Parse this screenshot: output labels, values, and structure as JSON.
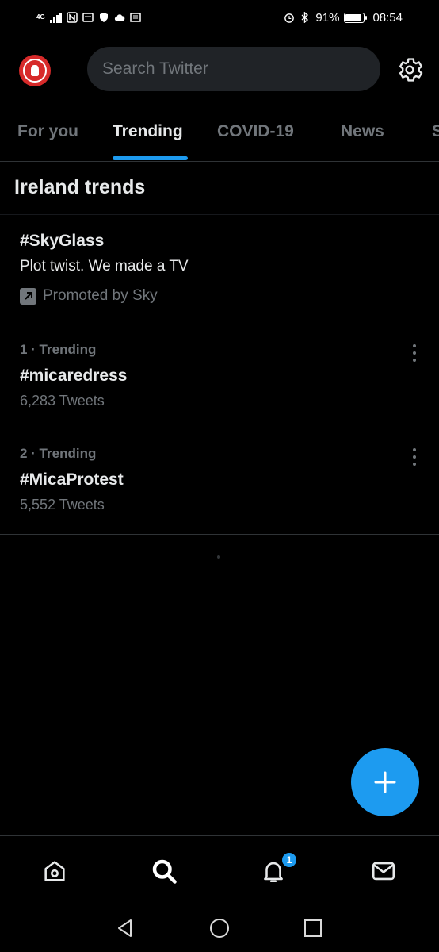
{
  "status_bar": {
    "network_type": "4G",
    "battery_percent": "91%",
    "battery_level": 0.91,
    "time": "08:54",
    "icons": [
      "signal-bars-icon",
      "nfc-icon",
      "news-icon",
      "shield-icon",
      "cloud-icon",
      "newspaper-icon",
      "alarm-icon",
      "bluetooth-icon",
      "battery-icon"
    ]
  },
  "header": {
    "avatar_icon": "profile-avatar-icon",
    "search_placeholder": "Search Twitter",
    "settings_icon": "gear-icon"
  },
  "tabs": [
    {
      "label": "For you",
      "active": false
    },
    {
      "label": "Trending",
      "active": true
    },
    {
      "label": "COVID-19",
      "active": false
    },
    {
      "label": "News",
      "active": false
    },
    {
      "label": "S",
      "active": false
    }
  ],
  "section_title": "Ireland trends",
  "promoted": {
    "title": "#SkyGlass",
    "description": "Plot twist. We made a TV",
    "promoted_label": "Promoted by Sky",
    "icon": "promoted-arrow-icon"
  },
  "trends": [
    {
      "meta": "1 · Trending",
      "name": "#micaredress",
      "count": "6,283 Tweets"
    },
    {
      "meta": "2 · Trending",
      "name": "#MicaProtest",
      "count": "5,552 Tweets"
    }
  ],
  "fab": {
    "icon": "plus-icon"
  },
  "bottom_nav": {
    "items": [
      "home-icon",
      "search-icon",
      "notifications-icon",
      "messages-icon"
    ],
    "notification_badge": "1"
  },
  "system_nav": [
    "back-icon",
    "home-circle-icon",
    "recents-icon"
  ],
  "colors": {
    "accent": "#1d9bf0",
    "background": "#000000",
    "muted_text": "#71767b",
    "primary_text": "#e7e9ea",
    "avatar": "#d72a2a"
  }
}
